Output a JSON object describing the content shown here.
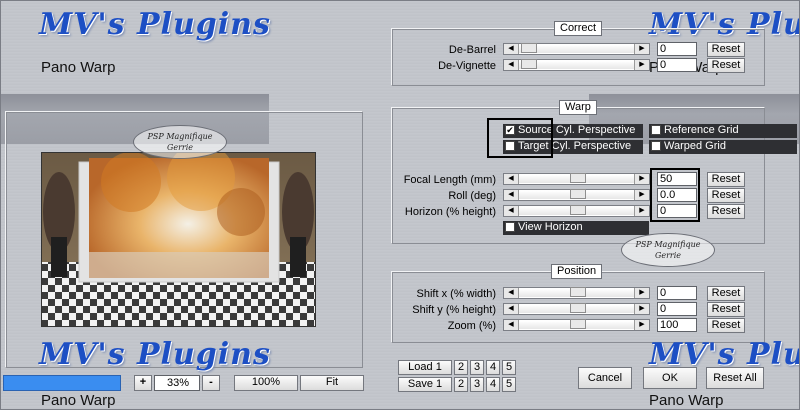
{
  "app": {
    "brand": "MV's Plugins",
    "name": "Pano Warp"
  },
  "watermark": {
    "line1": "PSP Magnifique",
    "line2": "Gerrie"
  },
  "correct": {
    "title": "Correct",
    "rows": [
      {
        "label": "De-Barrel",
        "value": "0",
        "level": 0.0,
        "reset": "Reset"
      },
      {
        "label": "De-Vignette",
        "value": "0",
        "level": 0.0,
        "reset": "Reset"
      }
    ]
  },
  "warp": {
    "title": "Warp",
    "source": {
      "label": "Source Cyl. Perspective",
      "checked": true
    },
    "target": {
      "label": "Target Cyl. Perspective",
      "checked": false
    },
    "reference_grid": {
      "label": "Reference Grid",
      "checked": false
    },
    "warped_grid": {
      "label": "Warped Grid",
      "checked": false
    },
    "rows": [
      {
        "label": "Focal Length (mm)",
        "value": "50",
        "level": 0.5,
        "reset": "Reset"
      },
      {
        "label": "Roll (deg)",
        "value": "0.0",
        "level": 0.5,
        "reset": "Reset"
      },
      {
        "label": "Horizon (% height)",
        "value": "0",
        "level": 0.5,
        "reset": "Reset"
      }
    ],
    "view_horizon": {
      "label": "View Horizon",
      "checked": false
    }
  },
  "position": {
    "title": "Position",
    "rows": [
      {
        "label": "Shift x (% width)",
        "value": "0",
        "level": 0.5,
        "reset": "Reset"
      },
      {
        "label": "Shift y (% height)",
        "value": "0",
        "level": 0.5,
        "reset": "Reset"
      },
      {
        "label": "Zoom (%)",
        "value": "100",
        "level": 0.5,
        "reset": "Reset"
      }
    ]
  },
  "zoom": {
    "plus": "+",
    "value": "33%",
    "minus": "-",
    "hundred": "100%",
    "fit": "Fit"
  },
  "presets": {
    "load": "Load 1",
    "save": "Save 1",
    "slots": [
      "2",
      "3",
      "4",
      "5"
    ]
  },
  "footer": {
    "cancel": "Cancel",
    "ok": "OK",
    "reset_all": "Reset All"
  },
  "colors": {
    "brand": "#1d4fc4",
    "progress": "#3a8df0",
    "panel_dark": "#2e2f33"
  }
}
